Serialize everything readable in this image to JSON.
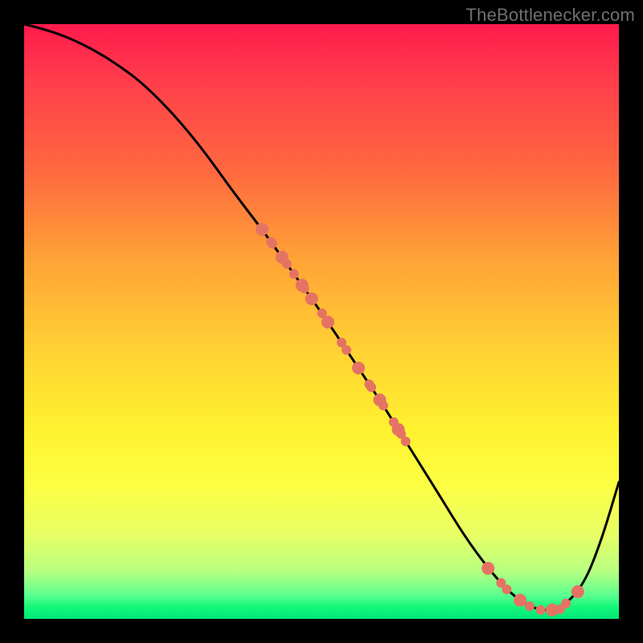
{
  "watermark": "TheBottlenecker.com",
  "chart_data": {
    "type": "line",
    "title": "",
    "xlabel": "",
    "ylabel": "",
    "xlim": [
      0,
      1
    ],
    "ylim": [
      0,
      1
    ],
    "series": [
      {
        "name": "curve",
        "x": [
          0.0,
          0.04,
          0.08,
          0.12,
          0.16,
          0.2,
          0.25,
          0.3,
          0.35,
          0.4,
          0.45,
          0.5,
          0.55,
          0.6,
          0.65,
          0.7,
          0.74,
          0.78,
          0.82,
          0.86,
          0.9,
          0.94,
          0.97,
          1.0
        ],
        "y": [
          1.0,
          0.99,
          0.975,
          0.955,
          0.93,
          0.9,
          0.85,
          0.79,
          0.72,
          0.655,
          0.585,
          0.515,
          0.44,
          0.365,
          0.285,
          0.205,
          0.14,
          0.085,
          0.04,
          0.015,
          0.015,
          0.055,
          0.13,
          0.23
        ]
      }
    ],
    "dot_clusters": [
      {
        "start_i": 9,
        "end_i": 14,
        "count": 24
      },
      {
        "start_i": 17,
        "end_i": 21,
        "count": 10
      }
    ],
    "colors": {
      "curve": "#000000",
      "dots": "#e57363"
    }
  }
}
